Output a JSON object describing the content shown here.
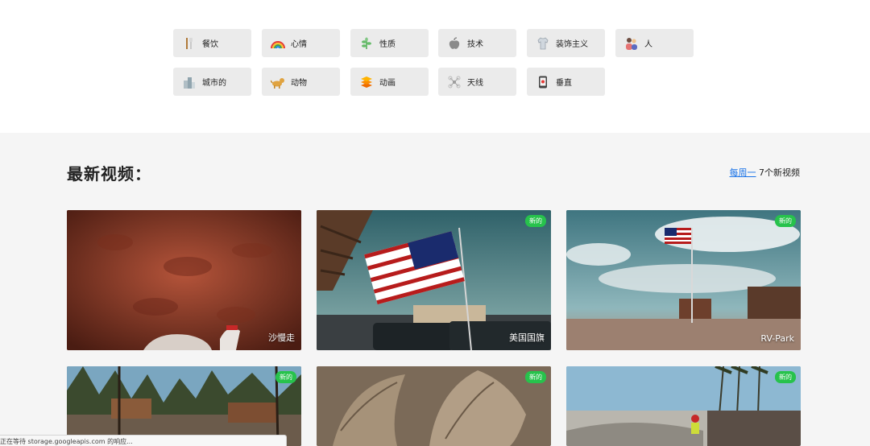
{
  "categories": [
    {
      "label": "餐饮",
      "icon": "utensils-icon"
    },
    {
      "label": "心情",
      "icon": "rainbow-icon"
    },
    {
      "label": "性质",
      "icon": "leaf-icon"
    },
    {
      "label": "技术",
      "icon": "apple-icon"
    },
    {
      "label": "装饰主义",
      "icon": "shirt-icon"
    },
    {
      "label": "人",
      "icon": "people-icon"
    },
    {
      "label": "城市的",
      "icon": "city-icon"
    },
    {
      "label": "动物",
      "icon": "dog-icon"
    },
    {
      "label": "动画",
      "icon": "layers-icon"
    },
    {
      "label": "天线",
      "icon": "drone-icon"
    },
    {
      "label": "垂直",
      "icon": "phone-icon"
    }
  ],
  "section": {
    "title": "最新视频：",
    "weekly_link": "每周一",
    "weekly_text": " 7个新视频"
  },
  "videos": [
    {
      "caption": "沙慢走",
      "badge": "",
      "scene": "red-sand"
    },
    {
      "caption": "美国国旗",
      "badge": "新的",
      "scene": "flag-street"
    },
    {
      "caption": "RV-Park",
      "badge": "新的",
      "scene": "desert-flag"
    },
    {
      "caption": "",
      "badge": "新的",
      "scene": "forest-town"
    },
    {
      "caption": "",
      "badge": "新的",
      "scene": "sand-texture"
    },
    {
      "caption": "",
      "badge": "新的",
      "scene": "skatepark"
    }
  ],
  "status": {
    "text": "正在等待 storage.googleapis.com 的响应..."
  },
  "colors": {
    "badge_green": "#27c24c",
    "link_blue": "#1a73e8",
    "tile_gray": "#ebebeb",
    "section_bg": "#f5f5f5"
  }
}
